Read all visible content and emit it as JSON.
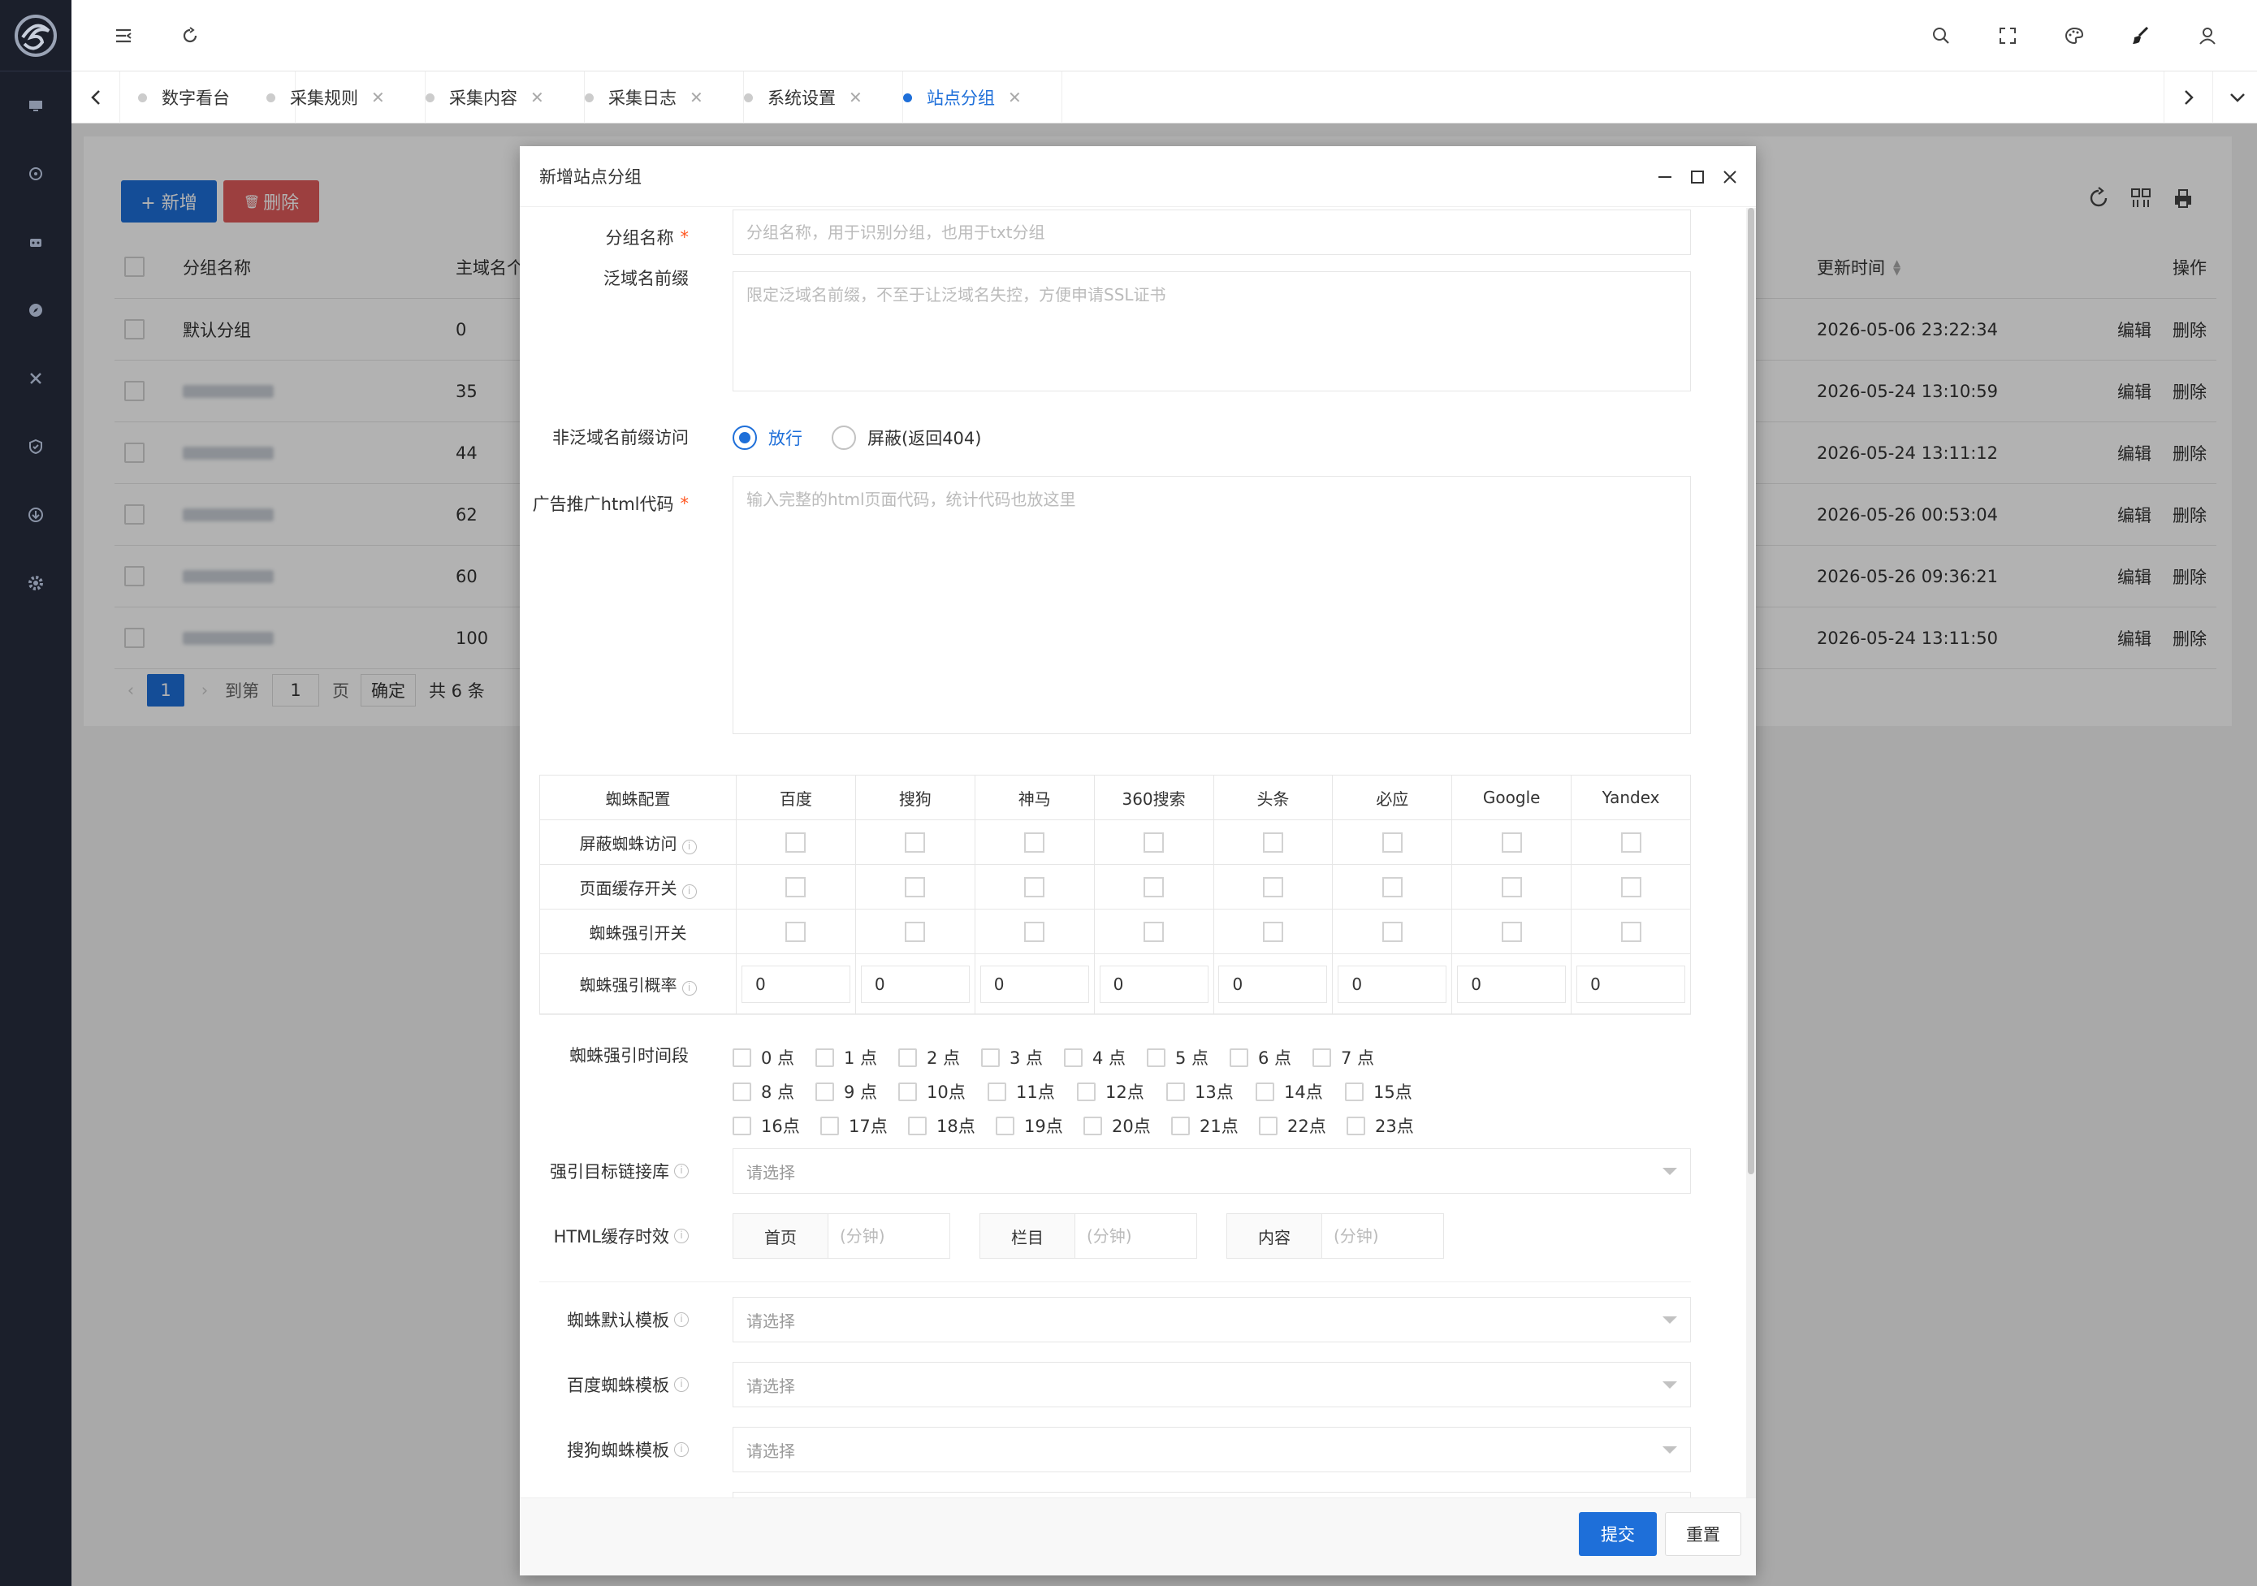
{
  "tabs": [
    {
      "label": "数字看台",
      "active": false
    },
    {
      "label": "采集规则",
      "active": false
    },
    {
      "label": "采集内容",
      "active": false
    },
    {
      "label": "采集日志",
      "active": false
    },
    {
      "label": "系统设置",
      "active": false
    },
    {
      "label": "站点分组",
      "active": true
    }
  ],
  "toolbar": {
    "add": "+ 新增",
    "delete": "删除"
  },
  "table": {
    "headers": {
      "name": "分组名称",
      "domains": "主域名个",
      "update_time": "更新时间",
      "ops": "操作"
    },
    "rows": [
      {
        "name": "默认分组",
        "count": "0",
        "time": "2026-05-06 23:22:34",
        "blur": false
      },
      {
        "name": "",
        "count": "35",
        "time": "2026-05-24 13:10:59",
        "blur": true
      },
      {
        "name": "",
        "count": "44",
        "time": "2026-05-24 13:11:12",
        "blur": true
      },
      {
        "name": "",
        "count": "62",
        "time": "2026-05-26 00:53:04",
        "blur": true
      },
      {
        "name": "",
        "count": "60",
        "time": "2026-05-26 09:36:21",
        "blur": true
      },
      {
        "name": "",
        "count": "100",
        "time": "2026-05-24 13:11:50",
        "blur": true
      }
    ],
    "edit": "编辑",
    "del": "删除"
  },
  "pager": {
    "page": "1",
    "goto": "到第",
    "page_input": "1",
    "page_unit": "页",
    "confirm": "确定",
    "total": "共 6 条"
  },
  "modal": {
    "title": "新增站点分组",
    "fields": {
      "group_name": {
        "label": "分组名称",
        "placeholder": "分组名称，用于识别分组，也用于txt分组"
      },
      "wildcard": {
        "label": "泛域名前缀",
        "placeholder": "限定泛域名前缀，不至于让泛域名失控，方便申请SSL证书"
      },
      "nonwild": {
        "label": "非泛域名前缀访问",
        "opt1": "放行",
        "opt2": "屏蔽(返回404)"
      },
      "ad_code": {
        "label": "广告推广html代码",
        "placeholder": "输入完整的html页面代码，统计代码也放这里"
      }
    },
    "spider": {
      "header": "蜘蛛配置",
      "engines": [
        "百度",
        "搜狗",
        "神马",
        "360搜索",
        "头条",
        "必应",
        "Google",
        "Yandex"
      ],
      "rows": [
        "屏蔽蜘蛛访问",
        "页面缓存开关",
        "蜘蛛强引开关"
      ],
      "rate_label": "蜘蛛强引概率",
      "rate_values": [
        "0",
        "0",
        "0",
        "0",
        "0",
        "0",
        "0",
        "0"
      ]
    },
    "hours": {
      "label": "蜘蛛强引时间段",
      "row1": [
        "0 点",
        "1 点",
        "2 点",
        "3 点",
        "4 点",
        "5 点",
        "6 点",
        "7 点"
      ],
      "row2": [
        "8 点",
        "9 点",
        "10点",
        "11点",
        "12点",
        "13点",
        "14点",
        "15点"
      ],
      "row3": [
        "16点",
        "17点",
        "18点",
        "19点",
        "20点",
        "21点",
        "22点",
        "23点"
      ]
    },
    "target_lib": {
      "label": "强引目标链接库",
      "placeholder": "请选择"
    },
    "html_cache": {
      "label": "HTML缓存时效",
      "home": "首页",
      "column": "栏目",
      "content": "内容",
      "unit": "(分钟)"
    },
    "tpl_default": {
      "label": "蜘蛛默认模板",
      "placeholder": "请选择"
    },
    "tpl_baidu": {
      "label": "百度蜘蛛模板",
      "placeholder": "请选择"
    },
    "tpl_sogou": {
      "label": "搜狗蜘蛛模板",
      "placeholder": "请选择"
    },
    "submit": "提交",
    "reset": "重置"
  },
  "colors": {
    "primary": "#1e6fd9",
    "danger": "#e05b5b",
    "sidebar": "#1b1f2b"
  }
}
